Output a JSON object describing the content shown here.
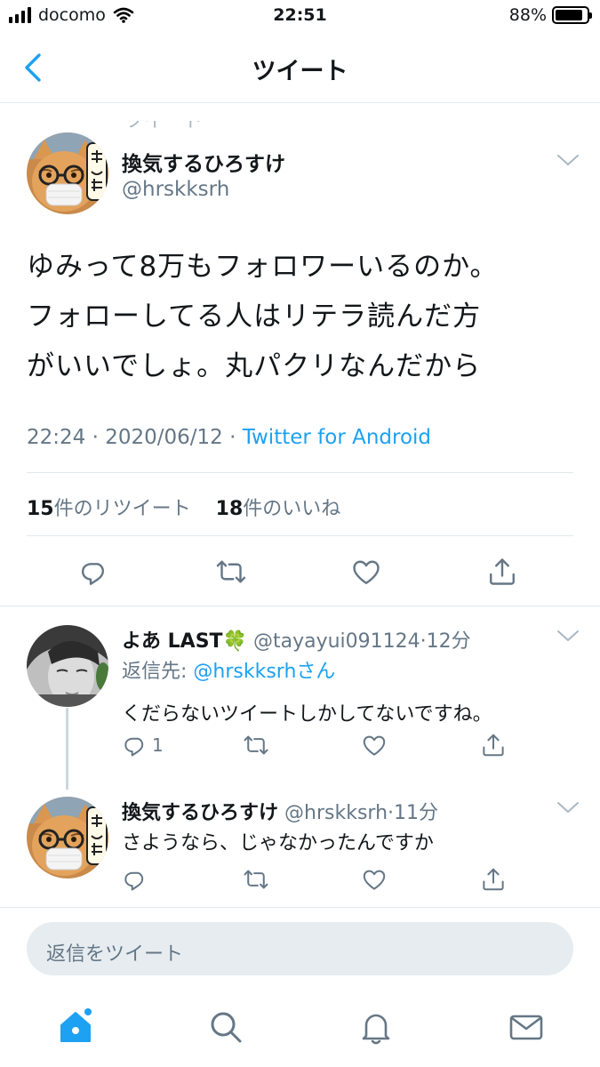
{
  "status_bar": {
    "carrier": "docomo",
    "time": "22:51",
    "battery_percent": "88%",
    "battery_level": 0.88
  },
  "header": {
    "title": "ツイート"
  },
  "previous_tweet_fragment": "ツイート",
  "main_tweet": {
    "author_name": "換気するひろすけ",
    "handle": "@hrskksrh",
    "text_lines": [
      "ゆみって8万もフォロワーいるのか。",
      "フォローしてる人はリテラ読んだ方",
      "がいいでしょ。丸パクリなんだから"
    ],
    "time": "22:24",
    "date": "2020/06/12",
    "client": "Twitter for Android",
    "retweets": "15",
    "retweets_label": "件のリツイート",
    "likes": "18",
    "likes_label": "件のいいね"
  },
  "replies": [
    {
      "name": "よあ LAST",
      "emoji": "🍀",
      "handle": "@tayayui091124",
      "time_ago": "12分",
      "replying_to_label": "返信先: ",
      "replying_to_handle": "@hrskksrhさん",
      "text": "くだらないツイートしかしてないですね。",
      "reply_count": "1"
    },
    {
      "name": "換気するひろすけ",
      "handle": "@hrskksrh",
      "time_ago": "11分",
      "text": "さようなら、じゃなかったんですか"
    }
  ],
  "compose": {
    "placeholder": "返信をツイート"
  },
  "colors": {
    "accent": "#1da1f2",
    "secondary_text": "#657786",
    "divider": "#e1e8ed"
  },
  "icons": [
    "back-chevron-icon",
    "chevron-down-icon",
    "reply-icon",
    "retweet-icon",
    "like-icon",
    "share-icon",
    "home-icon",
    "search-icon",
    "notifications-icon",
    "messages-icon"
  ]
}
